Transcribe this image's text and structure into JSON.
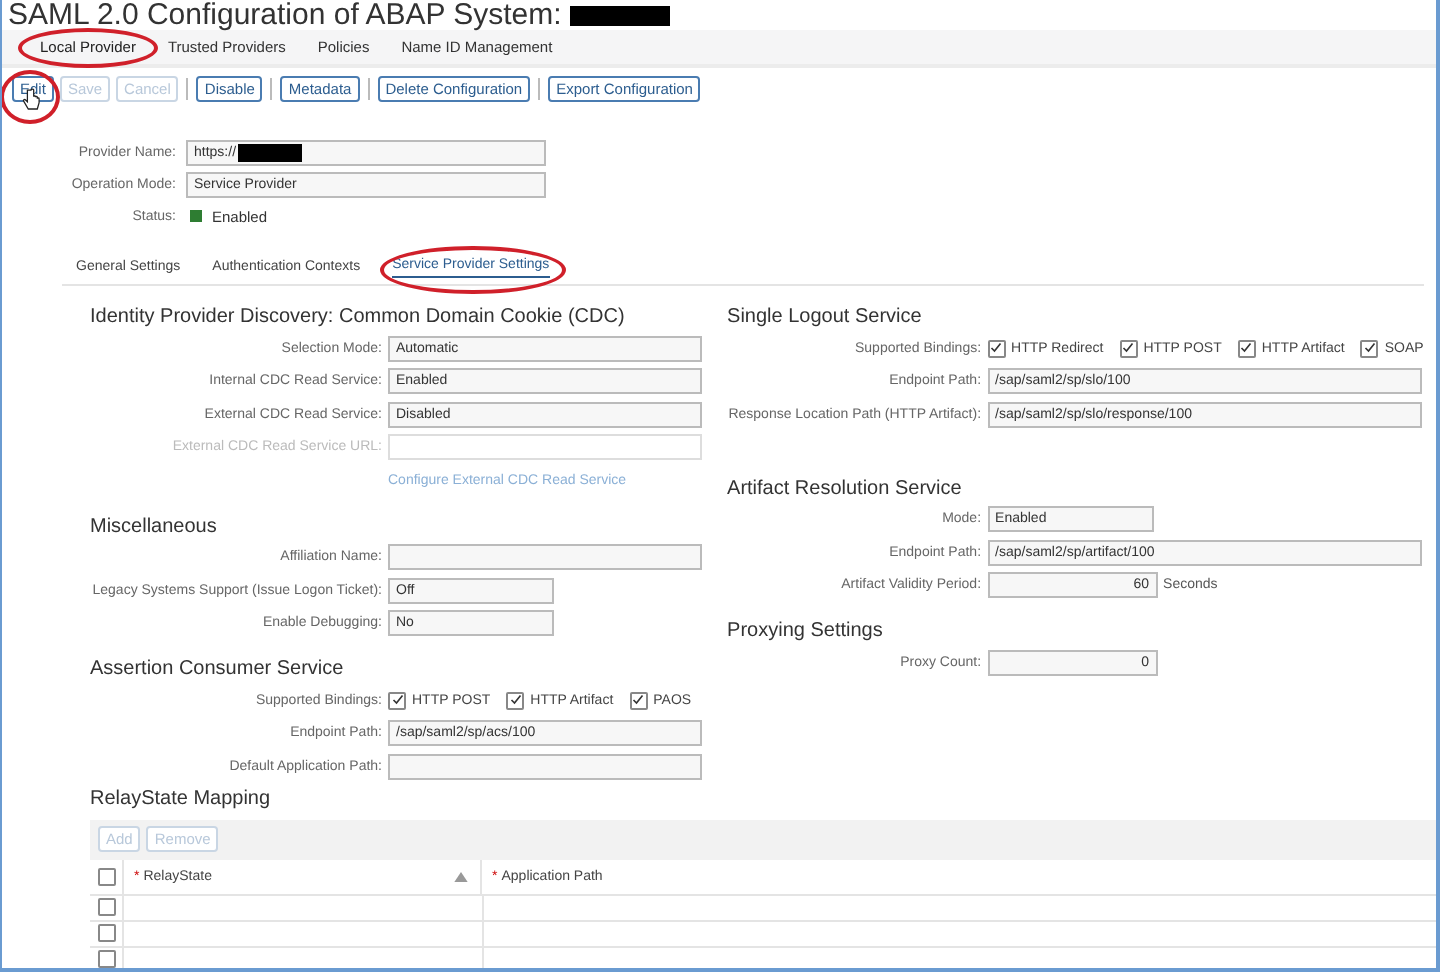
{
  "title": "SAML 2.0 Configuration of ABAP System:",
  "tabs": [
    {
      "label": "Local Provider",
      "selected": true,
      "circled": true
    },
    {
      "label": "Trusted Providers",
      "selected": false,
      "circled": false
    },
    {
      "label": "Policies",
      "selected": false,
      "circled": false
    },
    {
      "label": "Name ID Management",
      "selected": false,
      "circled": false
    }
  ],
  "toolbar": [
    {
      "label": "Edit",
      "disabled": false,
      "circled": true
    },
    {
      "label": "Save",
      "disabled": true,
      "circled": false
    },
    {
      "label": "Cancel",
      "disabled": true,
      "circled": false
    },
    {
      "label": "Disable",
      "disabled": false,
      "circled": false
    },
    {
      "label": "Metadata",
      "disabled": false,
      "circled": false
    },
    {
      "label": "Delete Configuration",
      "disabled": false,
      "circled": false
    },
    {
      "label": "Export Configuration",
      "disabled": false,
      "circled": false
    }
  ],
  "provider": [
    {
      "kind": "field",
      "label": "Provider Name:",
      "value": "https://",
      "redacted": true
    },
    {
      "kind": "field",
      "label": "Operation Mode:",
      "value": "Service Provider",
      "redacted": false
    },
    {
      "kind": "status",
      "label": "Status:",
      "value": "Enabled",
      "color": "#2e7d32"
    }
  ],
  "subtabs": [
    {
      "label": "General Settings",
      "selected": false,
      "circled": false
    },
    {
      "label": "Authentication Contexts",
      "selected": false,
      "circled": false
    },
    {
      "label": "Service Provider Settings",
      "selected": true,
      "circled": true
    }
  ],
  "left_sections": [
    {
      "title": "Identity Provider Discovery: Common Domain Cookie (CDC)",
      "rows": [
        {
          "kind": "field",
          "label": "Selection Mode:",
          "value": "Automatic",
          "disabled": false
        },
        {
          "kind": "field",
          "label": "Internal CDC Read Service:",
          "value": "Enabled",
          "disabled": false
        },
        {
          "kind": "field",
          "label": "External CDC Read Service:",
          "value": "Disabled",
          "disabled": false
        },
        {
          "kind": "field",
          "label": "External CDC Read Service URL:",
          "value": "",
          "disabled": true
        },
        {
          "kind": "link",
          "label": "Configure External CDC Read Service",
          "disabled": true
        }
      ]
    },
    {
      "title": "Miscellaneous",
      "rows": [
        {
          "kind": "field",
          "label": "Affiliation Name:",
          "value": "",
          "disabled": false
        },
        {
          "kind": "short",
          "label": "Legacy Systems Support (Issue Logon Ticket):",
          "value": "Off",
          "disabled": false
        },
        {
          "kind": "short",
          "label": "Enable Debugging:",
          "value": "No",
          "disabled": false
        }
      ]
    },
    {
      "title": "Assertion Consumer Service",
      "rows": [
        {
          "kind": "checks",
          "label": "Supported Bindings:",
          "options": [
            {
              "label": "HTTP POST",
              "checked": true
            },
            {
              "label": "HTTP Artifact",
              "checked": true
            },
            {
              "label": "PAOS",
              "checked": true
            }
          ]
        },
        {
          "kind": "field",
          "label": "Endpoint Path:",
          "value": "/sap/saml2/sp/acs/100",
          "disabled": false
        },
        {
          "kind": "field",
          "label": "Default Application Path:",
          "value": "",
          "disabled": false
        }
      ]
    }
  ],
  "right_sections": [
    {
      "title": "Single Logout Service",
      "rows": [
        {
          "kind": "checks",
          "label": "Supported Bindings:",
          "options": [
            {
              "label": "HTTP Redirect",
              "checked": true
            },
            {
              "label": "HTTP POST",
              "checked": true
            },
            {
              "label": "HTTP Artifact",
              "checked": true
            },
            {
              "label": "SOAP",
              "checked": true
            }
          ]
        },
        {
          "kind": "field",
          "label": "Endpoint Path:",
          "value": "/sap/saml2/sp/slo/100",
          "disabled": false
        },
        {
          "kind": "field",
          "label": "Response Location Path (HTTP Artifact):",
          "value": "/sap/saml2/sp/slo/response/100",
          "disabled": false
        }
      ]
    },
    {
      "title": "Artifact Resolution Service",
      "rows": [
        {
          "kind": "short",
          "label": "Mode:",
          "value": "Enabled",
          "disabled": false
        },
        {
          "kind": "field",
          "label": "Endpoint Path:",
          "value": "/sap/saml2/sp/artifact/100",
          "disabled": false
        },
        {
          "kind": "number",
          "label": "Artifact Validity Period:",
          "value": "60",
          "unit": "Seconds",
          "disabled": false
        }
      ]
    },
    {
      "title": "Proxying Settings",
      "rows": [
        {
          "kind": "number",
          "label": "Proxy Count:",
          "value": "0",
          "disabled": false
        }
      ]
    }
  ],
  "relay": {
    "title": "RelayState Mapping",
    "buttons": [
      {
        "label": "Add",
        "disabled": true
      },
      {
        "label": "Remove",
        "disabled": true
      }
    ],
    "all_checked": false,
    "columns": [
      {
        "mark": "*",
        "label": "RelayState",
        "sortable": true
      },
      {
        "mark": "*",
        "label": "Application Path",
        "sortable": false
      }
    ],
    "rows": [
      {
        "checked": false
      },
      {
        "checked": false
      },
      {
        "checked": false
      }
    ]
  }
}
